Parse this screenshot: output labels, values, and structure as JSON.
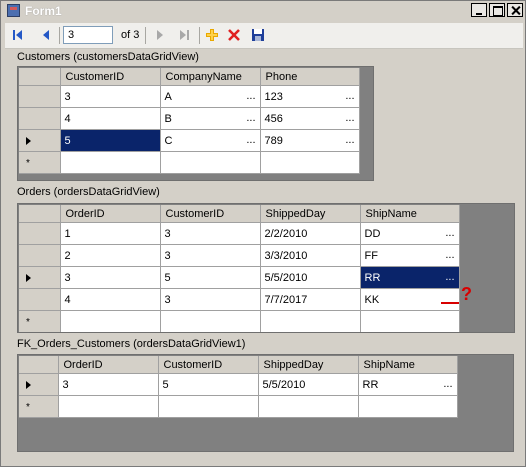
{
  "window": {
    "title": "Form1"
  },
  "title_buttons": {
    "minimize": "minimize",
    "maximize": "maximize",
    "close": "close"
  },
  "toolbar": {
    "position_value": "3",
    "count_label": "of 3"
  },
  "customers": {
    "label": "Customers (customersDataGridView)",
    "columns": [
      "CustomerID",
      "CompanyName",
      "Phone"
    ],
    "rows": [
      [
        "3",
        "A",
        "123"
      ],
      [
        "4",
        "B",
        "456"
      ],
      [
        "5",
        "C",
        "789"
      ]
    ]
  },
  "orders": {
    "label": "Orders (ordersDataGridView)",
    "columns": [
      "OrderID",
      "CustomerID",
      "ShippedDay",
      "ShipName"
    ],
    "rows": [
      [
        "1",
        "3",
        "2/2/2010",
        "DD"
      ],
      [
        "2",
        "3",
        "3/3/2010",
        "FF"
      ],
      [
        "3",
        "5",
        "5/5/2010",
        "RR"
      ],
      [
        "4",
        "3",
        "7/7/2017",
        "KK"
      ]
    ]
  },
  "fk": {
    "label": "FK_Orders_Customers (ordersDataGridView1)",
    "columns": [
      "OrderID",
      "CustomerID",
      "ShippedDay",
      "ShipName"
    ],
    "rows": [
      [
        "3",
        "5",
        "5/5/2010",
        "RR"
      ]
    ]
  },
  "annotation": {
    "mark": "?"
  },
  "ellipsis": "...",
  "new_row_marker": "*",
  "colors": {
    "selection": "#0a246a",
    "annotation": "#d80000"
  }
}
